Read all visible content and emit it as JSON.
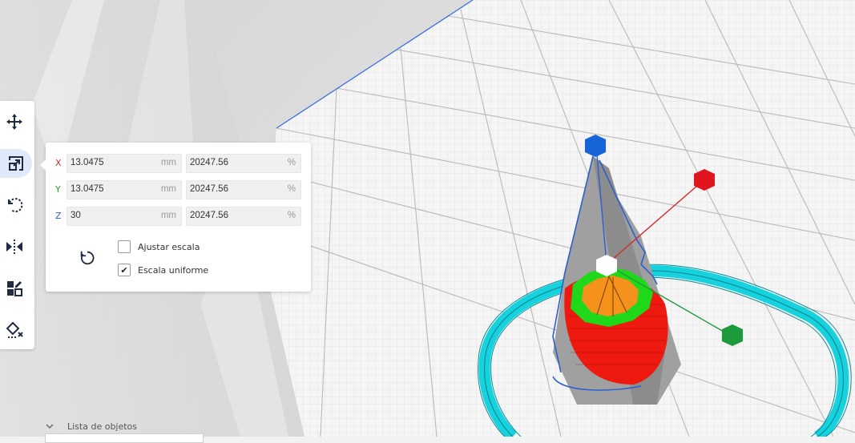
{
  "colors": {
    "axis_x": "#d22b2b",
    "axis_y": "#2aa02a",
    "axis_z": "#2b5fd1",
    "accent_active": "#dfe9f7",
    "handle_blue": "#1763d8",
    "handle_red": "#e0161e",
    "handle_green": "#1d9a3c",
    "skirt_cyan": "#16d2de",
    "model_red": "#ee1a10",
    "model_green": "#1fd81a",
    "model_orange": "#f5921c"
  },
  "toolbar": {
    "tools": [
      {
        "name": "move-tool",
        "icon": "move-icon"
      },
      {
        "name": "scale-tool",
        "icon": "scale-icon",
        "active": true
      },
      {
        "name": "rotate-tool",
        "icon": "rotate-icon"
      },
      {
        "name": "mirror-tool",
        "icon": "mirror-icon"
      },
      {
        "name": "per-model-settings-tool",
        "icon": "per-model-settings-icon"
      },
      {
        "name": "support-blocker-tool",
        "icon": "support-blocker-icon"
      }
    ]
  },
  "scale_panel": {
    "x": {
      "label": "X",
      "mm": "13.0475",
      "mm_unit": "mm",
      "percent": "20247.56",
      "percent_unit": "%"
    },
    "y": {
      "label": "Y",
      "mm": "13.0475",
      "mm_unit": "mm",
      "percent": "20247.56",
      "percent_unit": "%"
    },
    "z": {
      "label": "Z",
      "mm": "30",
      "mm_unit": "mm",
      "percent": "20247.56",
      "percent_unit": "%"
    },
    "reset_icon": "reset-icon",
    "snap_scaling": {
      "label": "Ajustar escala",
      "checked": false
    },
    "uniform_scaling": {
      "label": "Escala uniforme",
      "checked": true,
      "mark": "✔"
    }
  },
  "object_list": {
    "label": "Lista de objetos",
    "icon": "chevron-down-icon"
  }
}
